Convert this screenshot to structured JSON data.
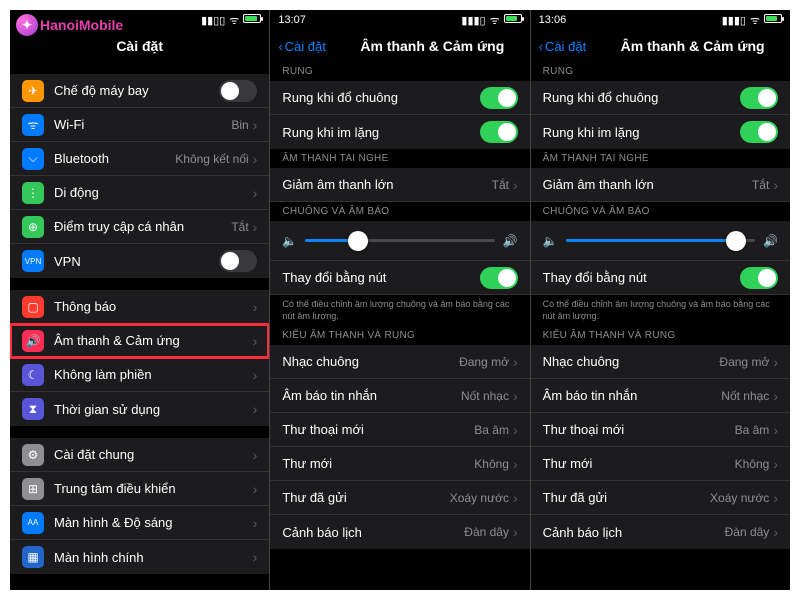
{
  "logo_text": "HanoiMobile",
  "panel1": {
    "time": "",
    "title": "Cài đặt",
    "groups": [
      [
        {
          "icon_bg": "#ff9500",
          "glyph": "✈",
          "label": "Chế độ máy bay",
          "type": "toggle",
          "on": false
        },
        {
          "icon_bg": "#007aff",
          "glyph": "ᯤ",
          "label": "Wi-Fi",
          "type": "detail",
          "detail": "Bin"
        },
        {
          "icon_bg": "#007aff",
          "glyph": "⌵",
          "label": "Bluetooth",
          "type": "detail",
          "detail": "Không kết nối"
        },
        {
          "icon_bg": "#34c759",
          "glyph": "⋮",
          "label": "Di động",
          "type": "chev",
          "detail": ""
        },
        {
          "icon_bg": "#34c759",
          "glyph": "⊕",
          "label": "Điểm truy cập cá nhân",
          "type": "detail",
          "detail": "Tắt"
        },
        {
          "icon_bg": "#007aff",
          "glyph": "VPN",
          "label": "VPN",
          "type": "toggle",
          "on": false,
          "small": true
        }
      ],
      [
        {
          "icon_bg": "#ff3b30",
          "glyph": "▢",
          "label": "Thông báo",
          "type": "chev"
        },
        {
          "icon_bg": "#ff2d55",
          "glyph": "🔊",
          "label": "Âm thanh & Cảm ứng",
          "type": "chev",
          "highlight": true
        },
        {
          "icon_bg": "#5856d6",
          "glyph": "☾",
          "label": "Không làm phiền",
          "type": "chev"
        },
        {
          "icon_bg": "#5856d6",
          "glyph": "⧗",
          "label": "Thời gian sử dụng",
          "type": "chev"
        }
      ],
      [
        {
          "icon_bg": "#8e8e93",
          "glyph": "⚙",
          "label": "Cài đặt chung",
          "type": "chev"
        },
        {
          "icon_bg": "#8e8e93",
          "glyph": "⊞",
          "label": "Trung tâm điều khiển",
          "type": "chev"
        },
        {
          "icon_bg": "#007aff",
          "glyph": "AA",
          "label": "Màn hình & Độ sáng",
          "type": "chev",
          "small": true
        },
        {
          "icon_bg": "#2266cc",
          "glyph": "▦",
          "label": "Màn hình chính",
          "type": "chev"
        }
      ]
    ]
  },
  "panel2": {
    "time": "13:07",
    "back": "Cài đặt",
    "title": "Âm thanh & Cảm ứng",
    "slider_pct": 28,
    "sections": {
      "rung_hdr": "RUNG",
      "rung": [
        {
          "label": "Rung khi đổ chuông",
          "on": true
        },
        {
          "label": "Rung khi im lặng",
          "on": true
        }
      ],
      "tai_nghe_hdr": "ÂM THANH TAI NGHE",
      "tai_nghe": {
        "label": "Giảm âm thanh lớn",
        "detail": "Tắt"
      },
      "chuong_hdr": "CHUÔNG VÀ ÂM BÁO",
      "thaydoi": {
        "label": "Thay đổi bằng nút",
        "on": true
      },
      "footer": "Có thể điều chỉnh âm lượng chuông và âm báo bằng các nút âm lượng.",
      "kieu_hdr": "KIỂU ÂM THANH VÀ RUNG",
      "kieu": [
        {
          "label": "Nhạc chuông",
          "detail": "Đang mở"
        },
        {
          "label": "Âm báo tin nhắn",
          "detail": "Nốt nhạc"
        },
        {
          "label": "Thư thoại mới",
          "detail": "Ba âm"
        },
        {
          "label": "Thư mới",
          "detail": "Không"
        },
        {
          "label": "Thư đã gửi",
          "detail": "Xoáy nước"
        },
        {
          "label": "Cảnh báo lịch",
          "detail": "Đàn dây"
        }
      ]
    }
  },
  "panel3": {
    "time": "13:06",
    "back": "Cài đặt",
    "title": "Âm thanh & Cảm ứng",
    "slider_pct": 90,
    "sections": {
      "rung_hdr": "RUNG",
      "rung": [
        {
          "label": "Rung khi đổ chuông",
          "on": true
        },
        {
          "label": "Rung khi im lặng",
          "on": true
        }
      ],
      "tai_nghe_hdr": "ÂM THANH TAI NGHE",
      "tai_nghe": {
        "label": "Giảm âm thanh lớn",
        "detail": "Tắt"
      },
      "chuong_hdr": "CHUÔNG VÀ ÂM BÁO",
      "thaydoi": {
        "label": "Thay đổi bằng nút",
        "on": true
      },
      "footer": "Có thể điều chỉnh âm lượng chuông và âm báo bằng các nút âm lượng.",
      "kieu_hdr": "KIỂU ÂM THANH VÀ RUNG",
      "kieu": [
        {
          "label": "Nhạc chuông",
          "detail": "Đang mở"
        },
        {
          "label": "Âm báo tin nhắn",
          "detail": "Nốt nhạc"
        },
        {
          "label": "Thư thoại mới",
          "detail": "Ba âm"
        },
        {
          "label": "Thư mới",
          "detail": "Không"
        },
        {
          "label": "Thư đã gửi",
          "detail": "Xoáy nước"
        },
        {
          "label": "Cảnh báo lịch",
          "detail": "Đàn dây"
        }
      ]
    }
  }
}
